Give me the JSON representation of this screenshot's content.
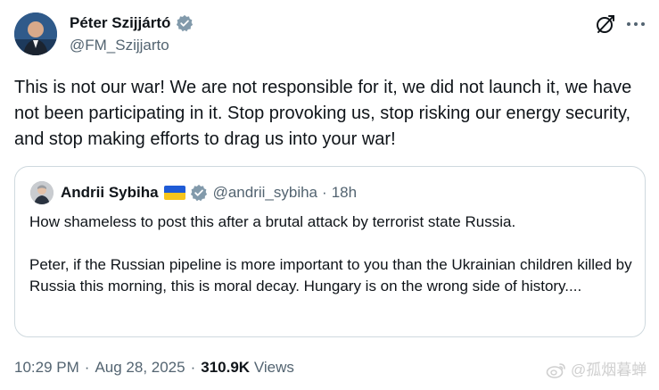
{
  "author": {
    "name": "Péter Szijjártó",
    "handle": "@FM_Szijjarto"
  },
  "tweet": {
    "text": "This is not our war! We are not responsible for it, we did not launch it, we have not been participating in it. Stop provoking us, stop risking our energy security, and stop making efforts to drag us into your war!"
  },
  "quote": {
    "author_name": "Andrii Sybiha",
    "flag_icon": "ukraine-flag-icon",
    "handle": "@andrii_sybiha",
    "dot": "·",
    "time": "18h",
    "paragraphs": [
      "How shameless to post this after a brutal attack by terrorist state Russia.",
      "Peter, if the Russian pipeline is more important to you than the Ukrainian children killed by Russia this morning, this is moral decay. Hungary is on the wrong side of history...."
    ]
  },
  "meta": {
    "time": "10:29 PM",
    "sep1": "·",
    "date": "Aug 28, 2025",
    "sep2": "·",
    "views_count": "310.9K",
    "views_label": "Views"
  },
  "watermark": {
    "text": "@孤烟暮蝉"
  },
  "colors": {
    "verified": "#829aab",
    "secondary_text": "#536471",
    "border": "#cfd9de",
    "flag_blue": "#1f5bd6",
    "flag_yellow": "#f7c51c"
  },
  "icons": [
    "verified-badge-icon",
    "grok-icon",
    "more-options-icon",
    "weibo-logo-icon"
  ]
}
